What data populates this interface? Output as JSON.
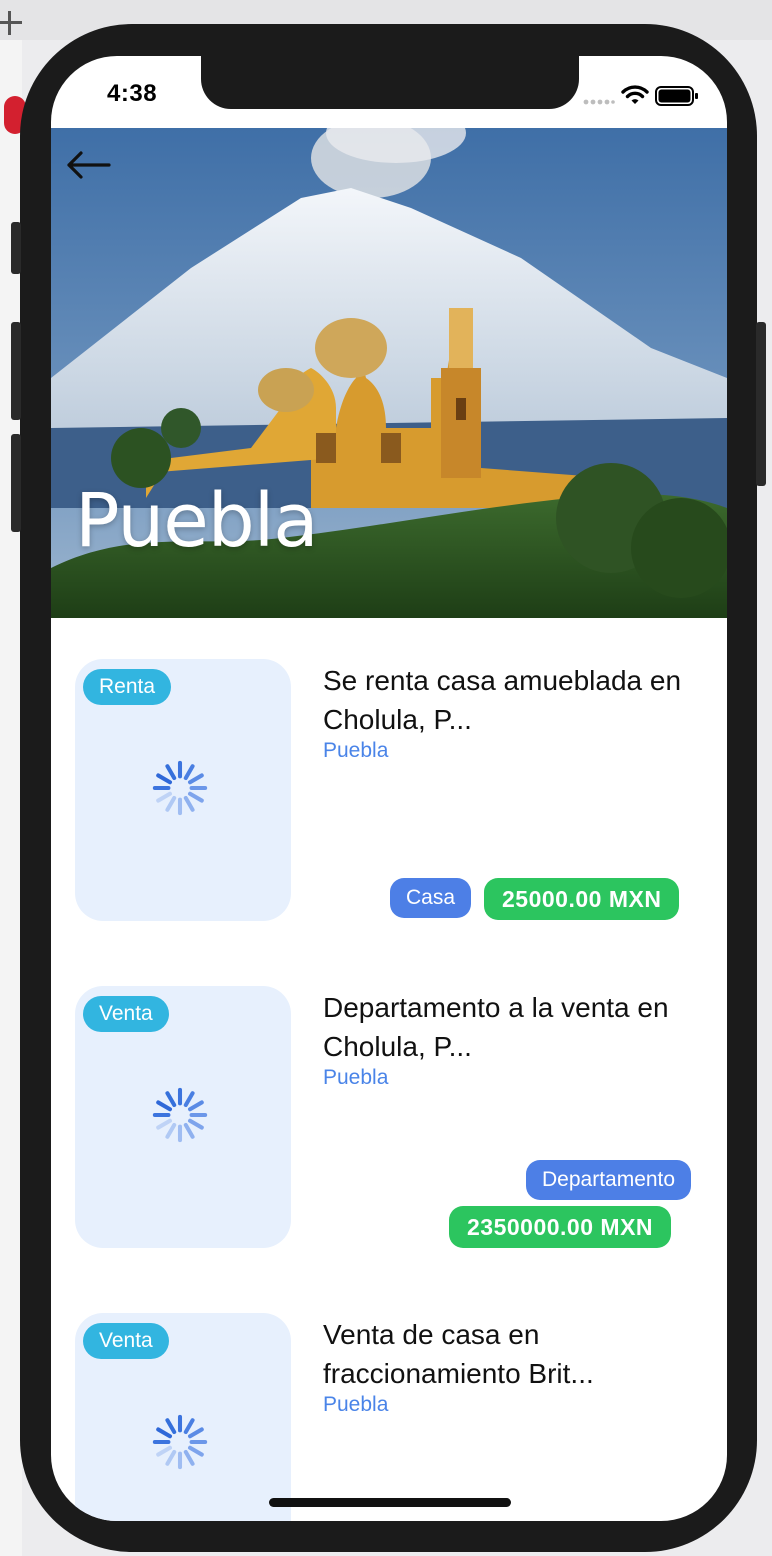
{
  "status_bar": {
    "time": "4:38"
  },
  "header": {
    "city_title": "Puebla",
    "back_icon": "arrow-left-icon"
  },
  "listings": [
    {
      "operation": "Renta",
      "title": "Se renta casa amueblada en Cholula, P...",
      "city": "Puebla",
      "property_type": "Casa",
      "price": "25000.00 MXN"
    },
    {
      "operation": "Venta",
      "title": "Departamento a la venta en Cholula, P...",
      "city": "Puebla",
      "property_type": "Departamento",
      "price": "2350000.00 MXN"
    },
    {
      "operation": "Venta",
      "title": "Venta de casa en fraccionamiento Brit...",
      "city": "Puebla"
    }
  ],
  "colors": {
    "operation_badge": "#32b5e0",
    "type_badge": "#4d7fe6",
    "price_badge": "#2cc55f",
    "city_link": "#4a84e8",
    "thumb_placeholder": "#e7f0fd"
  }
}
